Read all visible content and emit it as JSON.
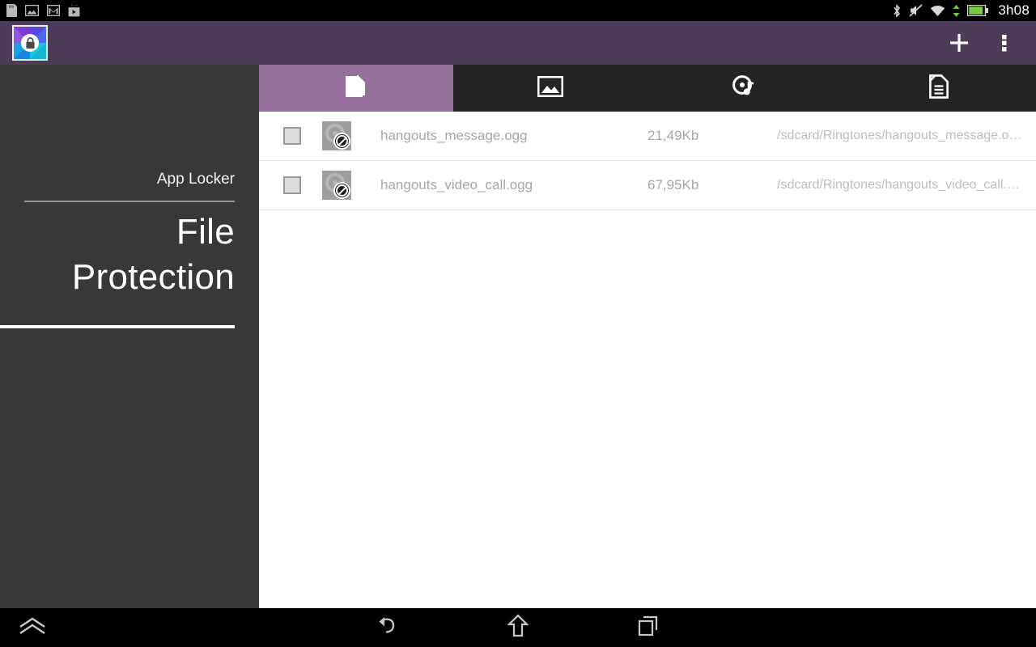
{
  "statusbar": {
    "left_icons": [
      "sdcard-icon",
      "gallery-icon",
      "gmail-icon",
      "play-store-icon"
    ],
    "right_icons": [
      "bluetooth-icon",
      "silent-mode-icon",
      "wifi-icon",
      "data-transfer-icon",
      "battery-icon"
    ],
    "time": "3h08"
  },
  "actionbar": {
    "app_icon_name": "app-locker-icon",
    "add_label": "+",
    "overflow_label": "⋮",
    "color": "#4d3c57"
  },
  "sidebar": {
    "items": [
      {
        "label": "App Locker",
        "selected": false
      },
      {
        "label_line1": "File",
        "label_line2": "Protection",
        "selected": true
      }
    ],
    "background": "#383838"
  },
  "tabs": [
    {
      "name": "tab-documents",
      "icon": "file-document-icon",
      "selected": true
    },
    {
      "name": "tab-images",
      "icon": "image-photo-icon",
      "selected": false
    },
    {
      "name": "tab-audio",
      "icon": "music-disc-icon",
      "selected": false
    },
    {
      "name": "tab-other-files",
      "icon": "text-document-icon",
      "selected": false
    }
  ],
  "tab_selected_color": "#94709a",
  "filelist": {
    "rows": [
      {
        "checked": false,
        "thumb": "blocked-preview-icon",
        "name": "hangouts_message.ogg",
        "size": "21,49Kb",
        "path": "/sdcard/Ringtones/hangouts_message.o…"
      },
      {
        "checked": false,
        "thumb": "blocked-preview-icon",
        "name": "hangouts_video_call.ogg",
        "size": "67,95Kb",
        "path": "/sdcard/Ringtones/hangouts_video_call.…"
      }
    ]
  },
  "navbar": {
    "buttons": [
      "expand-menu-icon",
      "back-icon",
      "home-icon",
      "recent-apps-icon"
    ]
  }
}
